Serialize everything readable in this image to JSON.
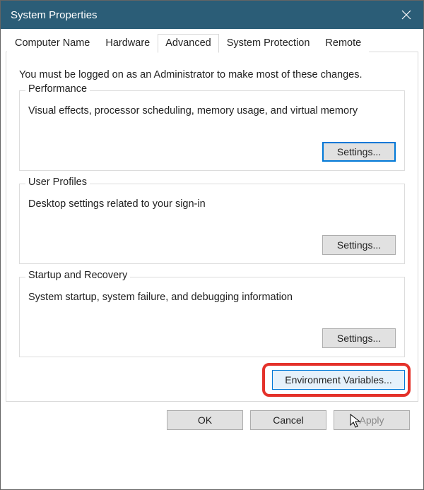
{
  "titlebar": {
    "title": "System Properties"
  },
  "tabs": {
    "computer_name": "Computer Name",
    "hardware": "Hardware",
    "advanced": "Advanced",
    "system_protection": "System Protection",
    "remote": "Remote"
  },
  "pane": {
    "intro": "You must be logged on as an Administrator to make most of these changes.",
    "performance": {
      "legend": "Performance",
      "desc": "Visual effects, processor scheduling, memory usage, and virtual memory",
      "settings_btn": "Settings..."
    },
    "user_profiles": {
      "legend": "User Profiles",
      "desc": "Desktop settings related to your sign-in",
      "settings_btn": "Settings..."
    },
    "startup_recovery": {
      "legend": "Startup and Recovery",
      "desc": "System startup, system failure, and debugging information",
      "settings_btn": "Settings..."
    },
    "env_vars_btn": "Environment Variables..."
  },
  "footer": {
    "ok": "OK",
    "cancel": "Cancel",
    "apply": "Apply"
  }
}
